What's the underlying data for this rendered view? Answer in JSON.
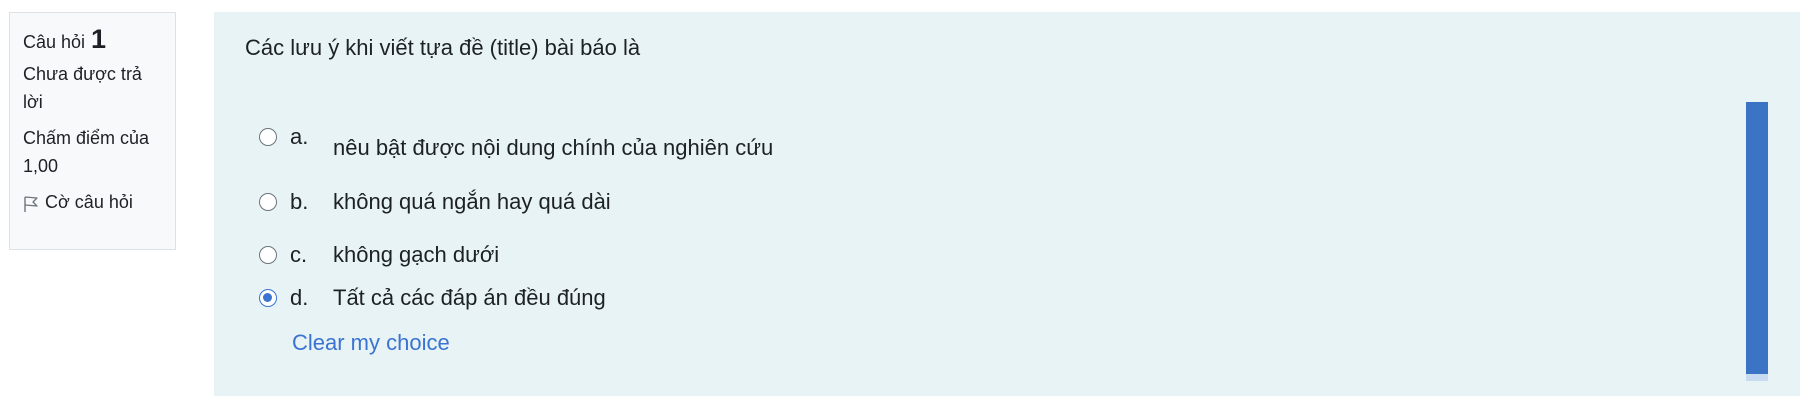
{
  "info": {
    "question_label": "Câu hỏi",
    "question_number": "1",
    "status": "Chưa được trả lời",
    "grade": "Chấm điểm của 1,00",
    "flag_label": "Cờ câu hỏi",
    "flag_icon": "flag-icon"
  },
  "question": {
    "text": "Các lưu ý khi viết tựa đề (title) bài báo là",
    "answers": [
      {
        "letter": "a.",
        "text": "nêu bật được nội dung chính của nghiên cứu",
        "checked": false
      },
      {
        "letter": "b.",
        "text": "không quá ngắn hay quá dài",
        "checked": false
      },
      {
        "letter": "c.",
        "text": "không gạch dưới",
        "checked": false
      },
      {
        "letter": "d.",
        "text": "Tất cả các đáp án đều đúng",
        "checked": true
      }
    ],
    "clear_label": "Clear my choice"
  },
  "colors": {
    "accent": "#3b73d1",
    "panel_bg": "#e7f3f5",
    "info_bg": "#f8f9fa"
  }
}
